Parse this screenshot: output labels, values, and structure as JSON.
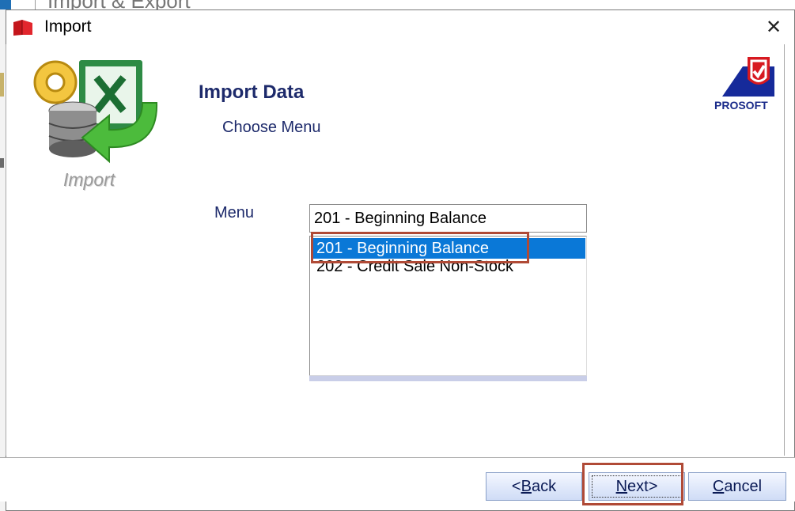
{
  "background_window": {
    "title": "Import & Export"
  },
  "dialog": {
    "title": "Import",
    "close_symbol": "✕",
    "hero_label": "Import",
    "heading": "Import Data",
    "subheading": "Choose Menu",
    "logo_text": "PROSOFT",
    "menu_label": "Menu",
    "menu_selected_value": "201 - Beginning Balance",
    "menu_options": [
      {
        "label": "201 - Beginning Balance",
        "selected": true
      },
      {
        "label": "202 - Credit Sale Non-Stock",
        "selected": false
      }
    ],
    "buttons": {
      "back_prefix": "<",
      "back_key": "B",
      "back_rest": "ack",
      "next_key": "N",
      "next_rest": "ext>",
      "cancel_key": "C",
      "cancel_rest": "ancel"
    }
  },
  "colors": {
    "accent_selection": "#0a78d7",
    "heading_text": "#1d2a6b",
    "annotation_highlight": "#b04a36"
  },
  "icons": [
    "app-book-icon",
    "close-icon",
    "import-database-excel-icon",
    "prosoft-logo-icon"
  ]
}
